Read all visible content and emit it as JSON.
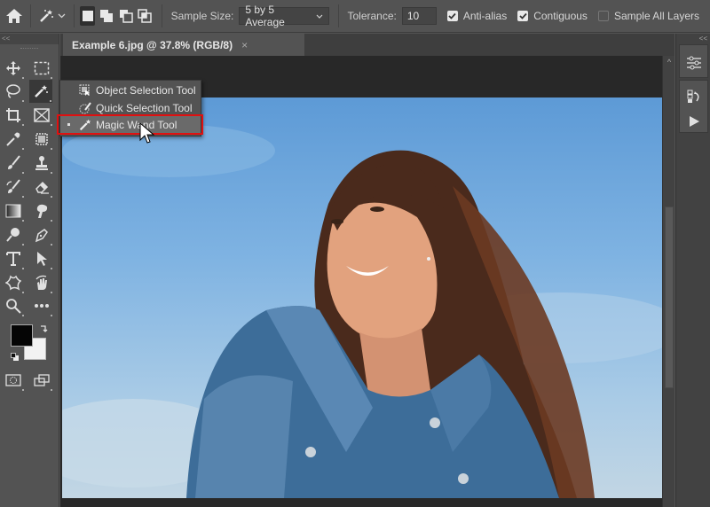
{
  "options_bar": {
    "home_icon": "home-icon",
    "tool_preset_icon": "magic-wand-icon",
    "selection_modes": [
      "new-selection",
      "add-to-selection",
      "subtract-from-selection",
      "intersect-with-selection"
    ],
    "sample_size_label": "Sample Size:",
    "sample_size_value": "5 by 5 Average",
    "tolerance_label": "Tolerance:",
    "tolerance_value": "10",
    "anti_alias": {
      "label": "Anti-alias",
      "checked": true
    },
    "contiguous": {
      "label": "Contiguous",
      "checked": true
    },
    "sample_all_layers": {
      "label": "Sample All Layers",
      "checked": false
    }
  },
  "toolbar": {
    "collapse_glyph": "<<",
    "tools": [
      "move-tool",
      "rectangular-marquee-tool",
      "lasso-tool",
      "magic-wand-tool",
      "crop-tool",
      "frame-tool",
      "eyedropper-tool",
      "spot-healing-brush-tool",
      "brush-tool",
      "clone-stamp-tool",
      "history-brush-tool",
      "eraser-tool",
      "gradient-tool",
      "smudge-tool",
      "dodge-tool",
      "pen-tool",
      "type-tool",
      "path-selection-tool",
      "custom-shape-tool",
      "hand-rotate-tool",
      "zoom-tool",
      "edit-toolbar-tool"
    ],
    "foreground_color": "#050505",
    "background_color": "#f2f2f2"
  },
  "document": {
    "tab_title": "Example 6.jpg @ 37.8% (RGB/8)",
    "close_glyph": "×"
  },
  "flyout": {
    "items": [
      {
        "label": "Object Selection Tool",
        "icon": "object-selection-icon",
        "active": false
      },
      {
        "label": "Quick Selection Tool",
        "icon": "quick-selection-icon",
        "active": false
      },
      {
        "label": "Magic Wand Tool",
        "icon": "magic-wand-icon",
        "active": true
      }
    ],
    "highlight_color": "#e01010"
  },
  "right_panel": {
    "collapse_glyph": "<<",
    "buttons": [
      "adjustments-icon",
      "history-icon",
      "play-actions-icon"
    ]
  },
  "scrollbar": {
    "up_glyph": "^"
  }
}
